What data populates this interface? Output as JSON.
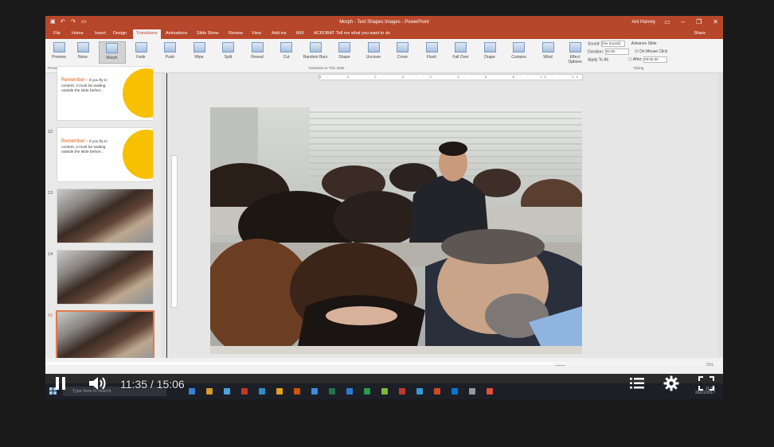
{
  "titlebar": {
    "title": "Morph - Text Shapes Images - PowerPoint",
    "user": "Ant Harvey"
  },
  "tabs": [
    "File",
    "Home",
    "Insert",
    "Design",
    "Transitions",
    "Animations",
    "Slide Show",
    "Review",
    "View",
    "Add-ins",
    "MIX",
    "ACROBAT"
  ],
  "active_tab": "Transitions",
  "tell_me": "Tell me what you want to do",
  "share": "Share",
  "ribbon": {
    "preview": "Preview",
    "transitions": [
      "None",
      "Morph",
      "Fade",
      "Push",
      "Wipe",
      "Split",
      "Reveal",
      "Cut",
      "Random Bars",
      "Shape",
      "Uncover",
      "Cover",
      "Flash",
      "Fall Over",
      "Drape",
      "Curtains",
      "Wind"
    ],
    "effect_options": "Effect Options",
    "group_transition": "Transition to This Slide",
    "group_preview": "Preview",
    "group_timing": "Timing",
    "sound_label": "Sound:",
    "sound_value": "[No Sound]",
    "duration_label": "Duration:",
    "duration_value": "02.00",
    "apply_all": "Apply To All",
    "advance_slide": "Advance Slide",
    "on_mouse_click": "On Mouse Click",
    "after_label": "After:",
    "after_value": "00:00.00"
  },
  "ruler_text": "6 · · · 4 · · · 2 · · · 0 · · · 2 · · · 4 · · · 6 · · · 8 · · · 10 · · · 12 · · · 14 · · · 16",
  "slides": [
    {
      "num": "",
      "kind": "text",
      "highlight": "Remember",
      "text": " – if you fly in content, it must be waiting outside the slide before..."
    },
    {
      "num": "12",
      "kind": "text",
      "highlight": "Remember",
      "text": " – if you fly in content, it must be waiting outside the slide before..."
    },
    {
      "num": "13",
      "kind": "photo"
    },
    {
      "num": "14",
      "kind": "photo"
    },
    {
      "num": "15",
      "kind": "photo",
      "selected": true
    }
  ],
  "status": {
    "notes": "Notes",
    "zoom": "75%"
  },
  "taskbar": {
    "search_placeholder": "Type here to search",
    "time": "11:35",
    "date": "26/01/2017"
  },
  "video": {
    "current": "11:35",
    "total": "15:06",
    "timecode": "11:35 / 15:06",
    "progress_fraction": 0.767
  },
  "colors": {
    "ppt_accent": "#b7472a",
    "thumb_yellow": "#f7c000",
    "thumb_orange": "#d55e1e"
  }
}
